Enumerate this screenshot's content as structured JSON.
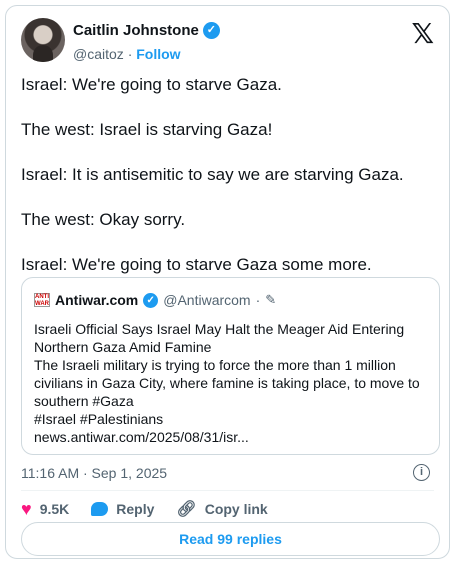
{
  "author": {
    "name": "Caitlin Johnstone",
    "handle": "@caitoz",
    "separator": "·",
    "follow_label": "Follow"
  },
  "tweet_lines": [
    "Israel: We're going to starve Gaza.",
    "The west: Israel is starving Gaza!",
    "Israel: It is antisemitic to say we are starving Gaza.",
    "The west: Okay sorry.",
    "Israel: We're going to starve Gaza some more."
  ],
  "quote": {
    "logo_text": "ANTI WAR",
    "name": "Antiwar.com",
    "handle": "@Antiwarcom",
    "separator": "·",
    "lines": [
      "Israeli Official Says Israel May Halt the Meager Aid Entering",
      "Northern Gaza Amid Famine",
      "The Israeli military is trying to force the more than 1 million",
      "civilians in Gaza City, where famine is taking place, to move to",
      "southern #Gaza",
      "#Israel #Palestinians",
      "news.antiwar.com/2025/08/31/isr..."
    ]
  },
  "meta": {
    "timestamp": "11:16 AM · Sep 1, 2025"
  },
  "actions": {
    "likes": "9.5K",
    "reply_label": "Reply",
    "copy_link_label": "Copy link"
  },
  "read_replies_label": "Read 99 replies",
  "icons": {
    "logo": "x-logo-icon",
    "verified": "verified-badge-icon",
    "like": "heart-icon",
    "reply": "reply-bubble-icon",
    "copy": "link-icon",
    "info": "info-icon",
    "edit": "pencil-icon"
  },
  "colors": {
    "accent": "#1d9bf0",
    "like": "#f91880",
    "muted": "#536471",
    "border": "#cfd9de"
  }
}
